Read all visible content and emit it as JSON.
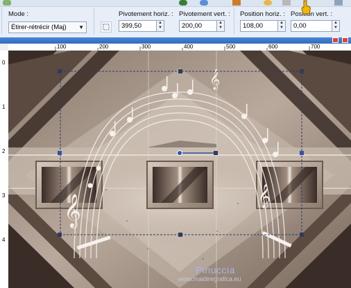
{
  "toolbar": {
    "mode_label": "Mode :",
    "mode_value": "Étirer-rétrécir (Maj)",
    "pivot_h_label": "Pivotement horiz. :",
    "pivot_h_value": "399,50",
    "pivot_v_label": "Pivotement vert. :",
    "pivot_v_value": "200,00",
    "pos_h_label": "Position horiz. :",
    "pos_h_value": "108,00",
    "pos_v_label": "Position vert. :",
    "pos_v_value": "0,00"
  },
  "ruler": {
    "horizontal": [
      "100",
      "200",
      "300",
      "400",
      "500",
      "600",
      "700"
    ],
    "vertical": [
      "0",
      "1",
      "2",
      "3",
      "4"
    ]
  },
  "watermark": {
    "name": "Pinuccia",
    "url": "www.maidiregrafica.eu"
  },
  "colors": {
    "toolbar_bg": "#e7eef8",
    "canvas_dark": "#3a2d27",
    "canvas_light": "#b9a99c",
    "selection": "#2f54a8"
  }
}
